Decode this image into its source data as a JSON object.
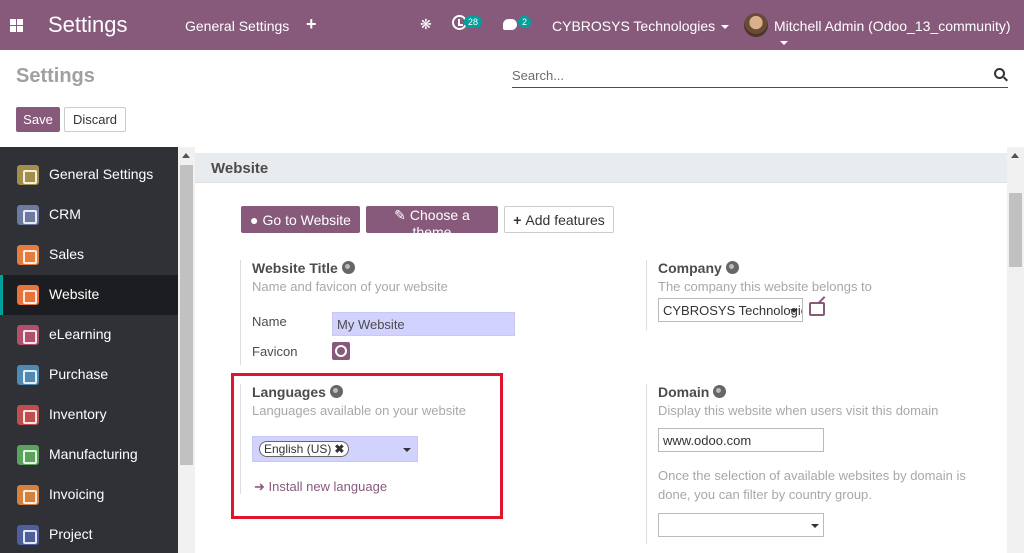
{
  "navbar": {
    "brand": "Settings",
    "menu": "General Settings",
    "plus": "+",
    "activity_count": "28",
    "message_count": "2",
    "company": "CYBROSYS Technologies",
    "user": "Mitchell Admin (Odoo_13_community)"
  },
  "control_panel": {
    "title": "Settings",
    "search_placeholder": "Search...",
    "save_label": "Save",
    "discard_label": "Discard"
  },
  "sidebar": {
    "items": [
      {
        "label": "General Settings",
        "color": "#a38d4b"
      },
      {
        "label": "CRM",
        "color": "#6c7aa1"
      },
      {
        "label": "Sales",
        "color": "#e47c3e"
      },
      {
        "label": "Website",
        "color": "#e8743b"
      },
      {
        "label": "eLearning",
        "color": "#b0506d"
      },
      {
        "label": "Purchase",
        "color": "#4e8ab5"
      },
      {
        "label": "Inventory",
        "color": "#c04e4e"
      },
      {
        "label": "Manufacturing",
        "color": "#5aa35a"
      },
      {
        "label": "Invoicing",
        "color": "#d4803e"
      },
      {
        "label": "Project",
        "color": "#4d5f9e"
      }
    ]
  },
  "main": {
    "section_title": "Website",
    "buttons": {
      "go_to_website": "Go to Website",
      "choose_theme": "Choose a theme",
      "add_features": "Add features"
    },
    "website_title": {
      "title": "Website Title",
      "help": "Name and favicon of your website",
      "name_label": "Name",
      "name_value": "My Website",
      "favicon_label": "Favicon"
    },
    "company": {
      "title": "Company",
      "help": "The company this website belongs to",
      "value": "CYBROSYS Technologies"
    },
    "languages": {
      "title": "Languages",
      "help": "Languages available on your website",
      "tag": "English (US)",
      "install_link": "Install new language"
    },
    "domain": {
      "title": "Domain",
      "help": "Display this website when users visit this domain",
      "value": "www.odoo.com",
      "note_line1": "Once the selection of available websites by domain is",
      "note_line2": "done, you can filter by country group."
    }
  }
}
